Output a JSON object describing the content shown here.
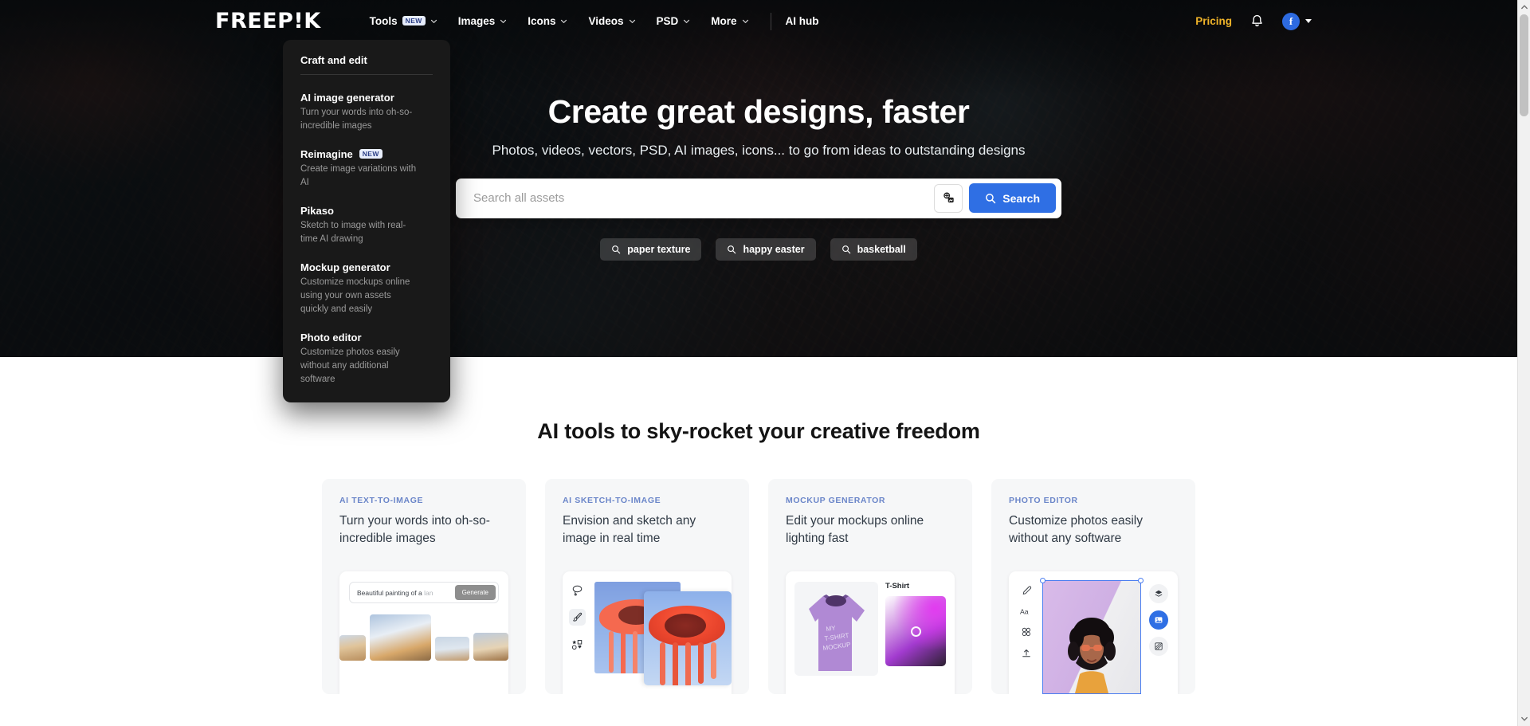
{
  "navbar": {
    "logo": "FREEP!K",
    "links": [
      {
        "label": "Tools",
        "badge": "NEW",
        "has_chevron": true
      },
      {
        "label": "Images",
        "badge": "",
        "has_chevron": true
      },
      {
        "label": "Icons",
        "badge": "",
        "has_chevron": true
      },
      {
        "label": "Videos",
        "badge": "",
        "has_chevron": true
      },
      {
        "label": "PSD",
        "badge": "",
        "has_chevron": true
      },
      {
        "label": "More",
        "badge": "",
        "has_chevron": true
      }
    ],
    "ai_hub": "AI hub",
    "pricing": "Pricing",
    "pricing_color": "#f0b429",
    "bell_icon": "bell-icon",
    "avatar_letter": "f",
    "avatar_color": "#2d6ae0"
  },
  "dropdown": {
    "title": "Craft and edit",
    "items": [
      {
        "title": "AI image generator",
        "badge": "",
        "desc": "Turn your words into oh-so-incredible images"
      },
      {
        "title": "Reimagine",
        "badge": "NEW",
        "desc": "Create image variations with AI"
      },
      {
        "title": "Pikaso",
        "badge": "",
        "desc": "Sketch to image with real-time AI drawing"
      },
      {
        "title": "Mockup generator",
        "badge": "",
        "desc": "Customize mockups online using your own assets quickly and easily"
      },
      {
        "title": "Photo editor",
        "badge": "",
        "desc": "Customize photos easily without any additional software"
      }
    ]
  },
  "hero": {
    "title": "Create great designs, faster",
    "subtitle": "Photos, videos, vectors, PSD, AI images, icons... to go from ideas to outstanding designs",
    "search_placeholder": "Search all assets",
    "search_value": "",
    "image_search_icon": "image-search-icon",
    "search_button": "Search",
    "search_button_color": "#2f6fe4",
    "chips": [
      {
        "label": "paper texture",
        "icon": "search-icon"
      },
      {
        "label": "happy easter",
        "icon": "search-icon"
      },
      {
        "label": "basketball",
        "icon": "search-icon"
      }
    ]
  },
  "tools_section": {
    "heading": "AI tools to sky-rocket your creative freedom",
    "cards": [
      {
        "kicker": "AI TEXT-TO-IMAGE",
        "title": "Turn your words into oh-so-incredible images",
        "preview": {
          "prompt": "Beautiful painting of a ",
          "prompt_dim": "lan",
          "button": "Generate"
        }
      },
      {
        "kicker": "AI SKETCH-TO-IMAGE",
        "title": "Envision and sketch any image in real time",
        "preview": {
          "tools": [
            "lasso-icon",
            "brush-icon",
            "shapes-icon"
          ]
        }
      },
      {
        "kicker": "MOCKUP GENERATOR",
        "title": "Edit your mockups online lighting fast",
        "preview": {
          "label": "T-Shirt",
          "shirt_text": "MY T-SHIRT MOCKUP"
        }
      },
      {
        "kicker": "PHOTO EDITOR",
        "title": "Customize photos easily without any software",
        "preview": {
          "tools": [
            "pencil-icon",
            "text-icon",
            "sticker-icon",
            "upload-icon"
          ],
          "right_tools": [
            "layers-icon",
            "image-icon",
            "pattern-icon"
          ]
        }
      }
    ]
  },
  "scrollbar": {
    "position": "right",
    "thumb_visible": true
  }
}
